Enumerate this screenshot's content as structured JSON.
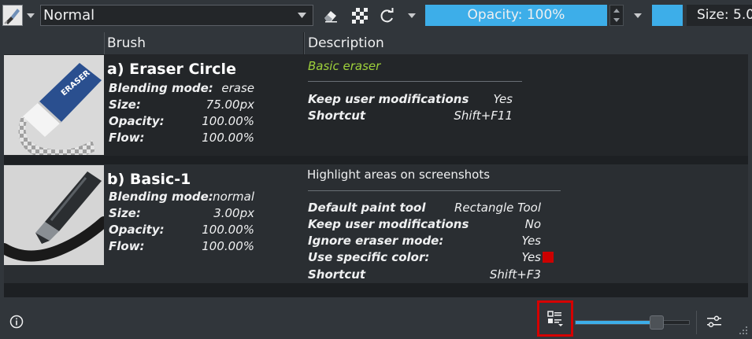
{
  "toolbar": {
    "blend_mode": "Normal",
    "opacity_label": "Opacity: 100%",
    "size_label": "Size: 5.0",
    "icons": [
      "brush-preset-icon",
      "eraser-icon",
      "alpha-checker-icon",
      "reload-icon"
    ],
    "accent": "#3daee9"
  },
  "table": {
    "headers": {
      "brush": "Brush",
      "description": "Description"
    },
    "presets": [
      {
        "name": "a) Eraser Circle",
        "props": [
          {
            "label": "Blending mode:",
            "value": "erase"
          },
          {
            "label": "Size:",
            "value": "75.00px"
          },
          {
            "label": "Opacity:",
            "value": "100.00%"
          },
          {
            "label": "Flow:",
            "value": "100.00%"
          }
        ],
        "description_title": "Basic eraser",
        "description_color": "#9ed13b",
        "details": [
          {
            "label": "Keep user modifications",
            "value": "Yes"
          },
          {
            "label": "Shortcut",
            "value": "Shift+F11"
          }
        ]
      },
      {
        "name": "b) Basic-1",
        "props": [
          {
            "label": "Blending mode:",
            "value": "normal"
          },
          {
            "label": "Size:",
            "value": "3.00px"
          },
          {
            "label": "Opacity:",
            "value": "100.00%"
          },
          {
            "label": "Flow:",
            "value": "100.00%"
          }
        ],
        "description_title": "Highlight areas on screenshots",
        "details": [
          {
            "label": "Default paint tool",
            "value": "Rectangle Tool"
          },
          {
            "label": "Keep user modifications",
            "value": "No"
          },
          {
            "label": "Ignore eraser mode:",
            "value": "Yes"
          },
          {
            "label": "Use specific color:",
            "value": "Yes",
            "swatch": "#cc0000"
          },
          {
            "label": "Shortcut",
            "value": "Shift+F3"
          }
        ]
      }
    ]
  },
  "bottom": {
    "zoom_fraction": 0.71,
    "icons": [
      "info-icon",
      "view-mode-icon",
      "settings-icon"
    ]
  }
}
